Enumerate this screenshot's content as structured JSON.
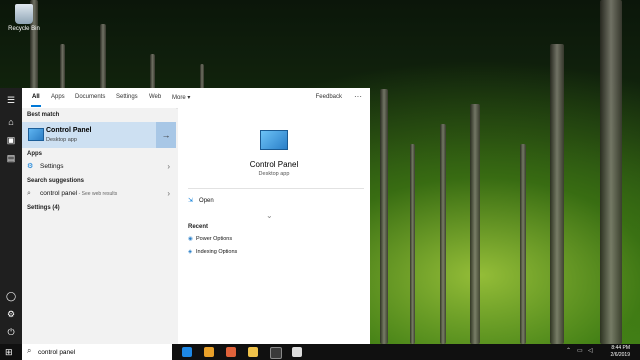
{
  "desktop": {
    "recycle_label": "Recycle Bin"
  },
  "tabs": [
    "All",
    "Apps",
    "Documents",
    "Settings",
    "Web",
    "More ▾"
  ],
  "feedback_label": "Feedback",
  "left": {
    "best_match_heading": "Best match",
    "best": {
      "title": "Control Panel",
      "subtitle": "Desktop app"
    },
    "apps_heading": "Apps",
    "apps": [
      {
        "label": "Settings"
      }
    ],
    "suggestions_heading": "Search suggestions",
    "suggestion": {
      "label": "control panel",
      "hint": " - See web results"
    },
    "settings_heading": "Settings (4)"
  },
  "right": {
    "title": "Control Panel",
    "subtitle": "Desktop app",
    "open_label": "Open",
    "recent_heading": "Recent",
    "recent": [
      "Power Options",
      "Indexing Options"
    ]
  },
  "taskbar": {
    "search_value": "control panel",
    "time": "8:44 PM",
    "date": "2/6/2019"
  },
  "icons": {
    "start": "windows-logo",
    "search": "magnifier",
    "arrow": "right-arrow",
    "chevron": "chevron-right"
  }
}
